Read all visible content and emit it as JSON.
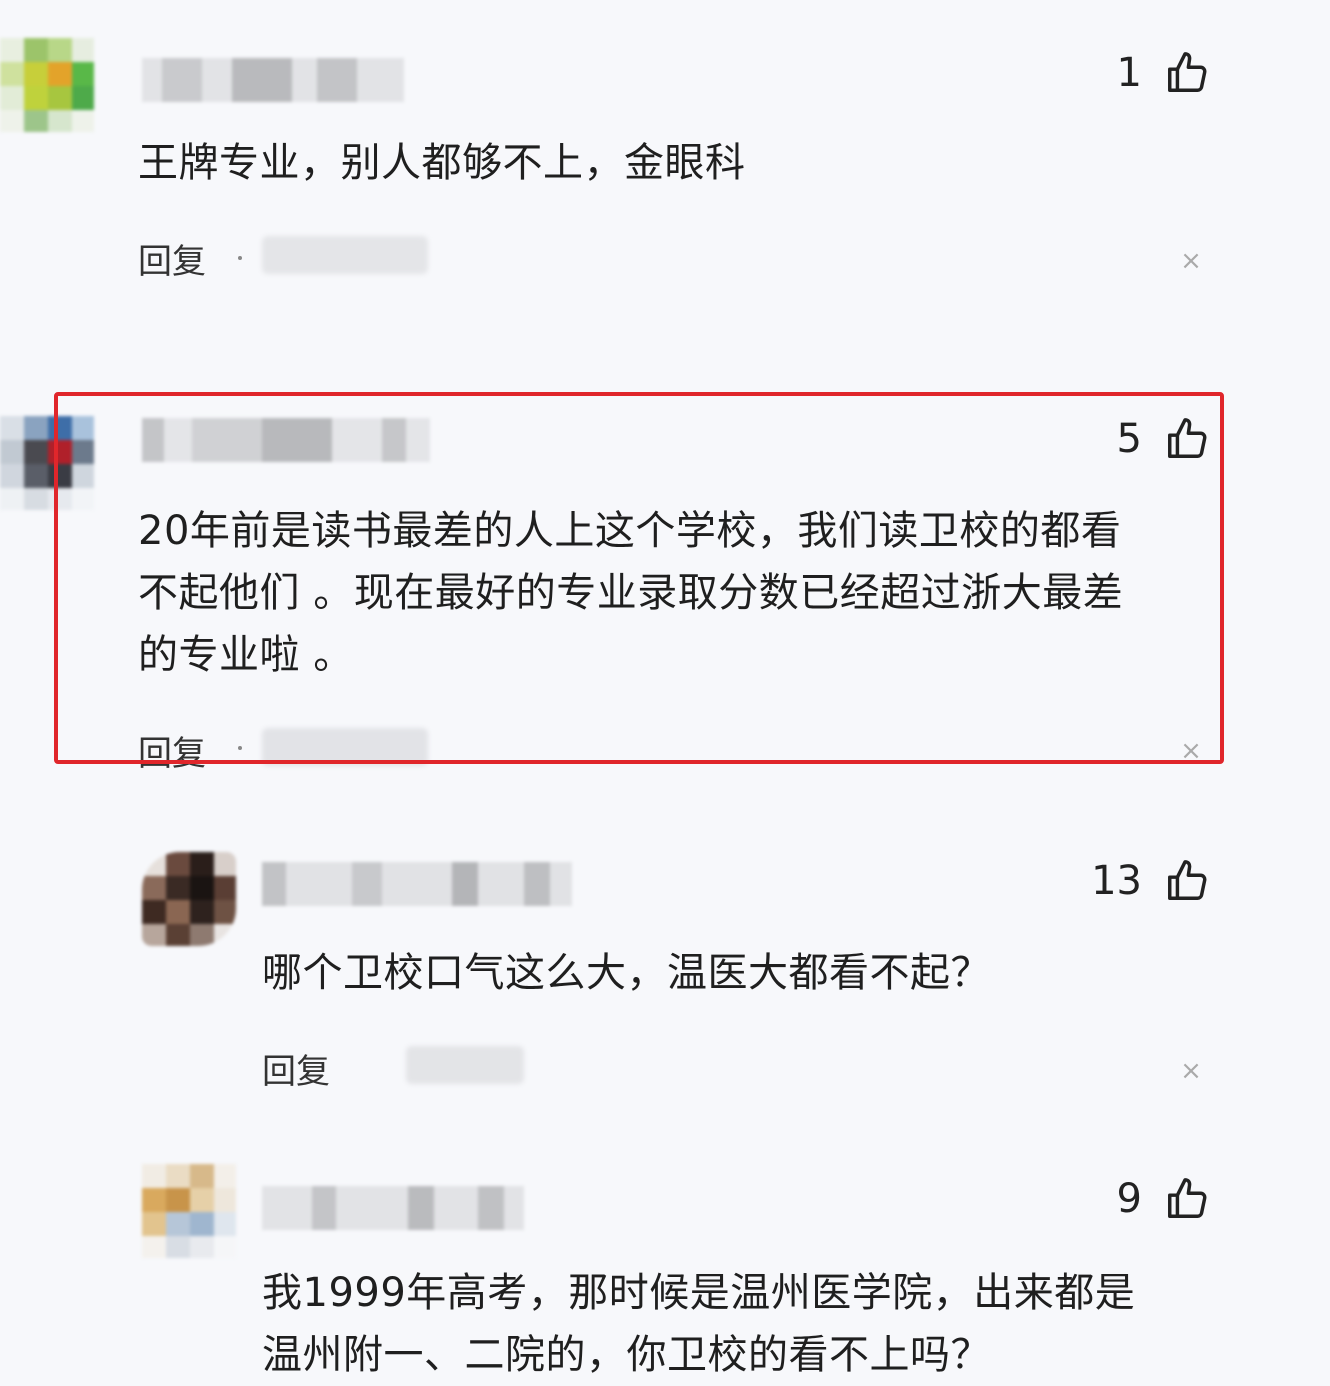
{
  "comments": [
    {
      "likes": "1",
      "text": "王牌专业，别人都够不上，金眼科",
      "reply_label": "回复"
    },
    {
      "likes": "5",
      "text": "20年前是读书最差的人上这个学校，我们读卫校的都看\n不起他们 。现在最好的专业录取分数已经超过浙大最差\n的专业啦 。",
      "reply_label": "回复"
    },
    {
      "likes": "13",
      "text": "哪个卫校口气这么大，温医大都看不起？",
      "reply_label": "回复"
    },
    {
      "likes": "9",
      "text": "我1999年高考，那时候是温州医学院，出来都是\n温州附一、二院的，你卫校的看不上吗？"
    }
  ],
  "icons": {
    "like": "thumbs-up-icon",
    "dismiss": "close-icon"
  },
  "colors": {
    "highlight_border": "#e0262b",
    "background": "#f7f8fb"
  }
}
